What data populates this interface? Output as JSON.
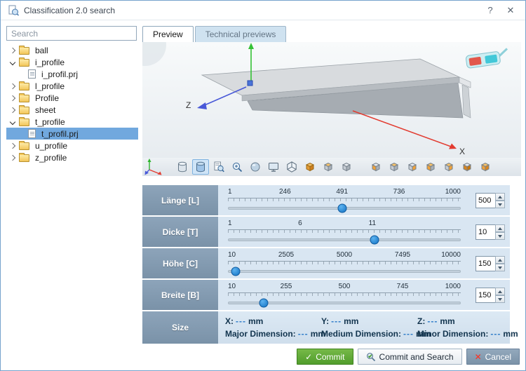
{
  "window": {
    "title": "Classification 2.0 search",
    "help": "?",
    "close": "✕"
  },
  "search": {
    "placeholder": "Search"
  },
  "tree": {
    "items": [
      {
        "label": "ball",
        "type": "folder",
        "expanded": false,
        "icon_name": "folder-icon"
      },
      {
        "label": "i_profile",
        "type": "folder",
        "expanded": true,
        "icon_name": "folder-icon"
      },
      {
        "label": "i_profil.prj",
        "type": "file",
        "selected": false,
        "icon_name": "project-file-icon"
      },
      {
        "label": "l_profile",
        "type": "folder",
        "expanded": false,
        "icon_name": "folder-icon"
      },
      {
        "label": "Profile",
        "type": "folder",
        "expanded": false,
        "icon_name": "folder-icon"
      },
      {
        "label": "sheet",
        "type": "folder",
        "expanded": false,
        "icon_name": "folder-icon"
      },
      {
        "label": "t_profile",
        "type": "folder",
        "expanded": true,
        "icon_name": "folder-icon"
      },
      {
        "label": "t_profil.prj",
        "type": "file",
        "selected": true,
        "icon_name": "project-file-icon"
      },
      {
        "label": "u_profile",
        "type": "folder",
        "expanded": false,
        "icon_name": "folder-icon"
      },
      {
        "label": "z_profile",
        "type": "folder",
        "expanded": false,
        "icon_name": "folder-icon"
      }
    ]
  },
  "tabs": [
    {
      "label": "Preview",
      "active": true
    },
    {
      "label": "Technical previews",
      "active": false
    }
  ],
  "preview": {
    "x_label": "X",
    "z_label": "Z"
  },
  "toolbar": {
    "main_icons": [
      {
        "name": "cylinder-view-icon",
        "symbol": "sym-cyl"
      },
      {
        "name": "cylinder-shaded-view-icon",
        "symbol": "sym-cyl2",
        "selected": true
      },
      {
        "name": "zoom-document-icon",
        "symbol": "sym-zoompage"
      },
      {
        "name": "zoom-icon",
        "symbol": "sym-zoom"
      },
      {
        "name": "sphere-view-icon",
        "symbol": "sym-sphere"
      },
      {
        "name": "fit-screen-icon",
        "symbol": "sym-screen"
      },
      {
        "name": "mesh-display-icon",
        "symbol": "sym-mesh"
      },
      {
        "name": "solid-display-icon",
        "symbol": "sym-box"
      },
      {
        "name": "shaded-cube-icon",
        "symbol": "sym-cube",
        "hl": "top"
      },
      {
        "name": "wireframe-cube-icon",
        "symbol": "sym-cube"
      }
    ],
    "view_icons": [
      {
        "name": "view-left-icon",
        "symbol": "sym-cube",
        "hl": "left"
      },
      {
        "name": "view-top-icon",
        "symbol": "sym-cube",
        "hl": "top"
      },
      {
        "name": "view-right-icon",
        "symbol": "sym-cube",
        "hl": "right"
      },
      {
        "name": "view-front-icon",
        "symbol": "sym-cube",
        "hl": "front"
      },
      {
        "name": "view-back-icon",
        "symbol": "sym-cube",
        "hl": "back"
      },
      {
        "name": "view-bottom-icon",
        "symbol": "sym-cube",
        "hl": "bottom"
      },
      {
        "name": "view-iso-icon",
        "symbol": "sym-cube",
        "hl": "all"
      }
    ]
  },
  "sliders": [
    {
      "label": "Länge [L]",
      "value": "500",
      "thumb_pct": 49,
      "ticks": [
        {
          "label": "1",
          "pct": 0
        },
        {
          "label": "246",
          "pct": 24.5
        },
        {
          "label": "491",
          "pct": 49
        },
        {
          "label": "736",
          "pct": 73.5
        },
        {
          "label": "1000",
          "pct": 100
        }
      ]
    },
    {
      "label": "Dicke [T]",
      "value": "10",
      "thumb_pct": 63,
      "ticks": [
        {
          "label": "1",
          "pct": 0
        },
        {
          "label": "6",
          "pct": 31
        },
        {
          "label": "11",
          "pct": 62
        }
      ]
    },
    {
      "label": "Höhe [C]",
      "value": "150",
      "thumb_pct": 3,
      "ticks": [
        {
          "label": "10",
          "pct": 0
        },
        {
          "label": "2505",
          "pct": 25
        },
        {
          "label": "5000",
          "pct": 50
        },
        {
          "label": "7495",
          "pct": 75
        },
        {
          "label": "10000",
          "pct": 100
        }
      ]
    },
    {
      "label": "Breite [B]",
      "value": "150",
      "thumb_pct": 15,
      "ticks": [
        {
          "label": "10",
          "pct": 0
        },
        {
          "label": "255",
          "pct": 25
        },
        {
          "label": "500",
          "pct": 50
        },
        {
          "label": "745",
          "pct": 75
        },
        {
          "label": "1000",
          "pct": 100
        }
      ]
    }
  ],
  "size": {
    "label": "Size",
    "row1": [
      {
        "name": "X:",
        "value": "---",
        "unit": "mm"
      },
      {
        "name": "Y:",
        "value": "---",
        "unit": "mm"
      },
      {
        "name": "Z:",
        "value": "---",
        "unit": "mm"
      }
    ],
    "row2": [
      {
        "name": "Major Dimension:",
        "value": "---",
        "unit": "mm"
      },
      {
        "name": "Medium Dimension:",
        "value": "---",
        "unit": "mm"
      },
      {
        "name": "Minor Dimension:",
        "value": "---",
        "unit": "mm"
      }
    ]
  },
  "footer": {
    "commit": "Commit",
    "commit_and_search": "Commit and Search",
    "cancel": "Cancel",
    "commit_icon": "✓",
    "cancel_icon": "✕"
  },
  "colors": {
    "accent_blue": "#1272c4",
    "header_gray_blue": "#7a92a8",
    "commit_green": "#519d2c",
    "cancel_red": "#ff2e1e"
  }
}
